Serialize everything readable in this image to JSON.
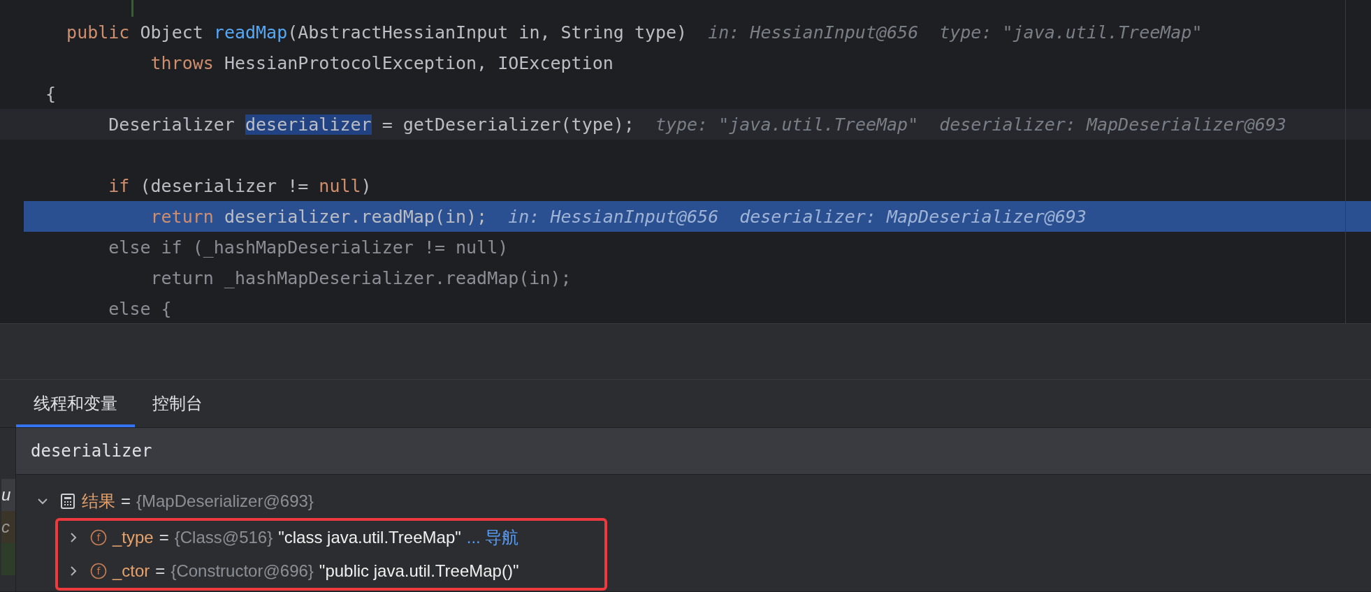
{
  "editor": {
    "lines": [
      {
        "current": false,
        "execution": false,
        "tokens": [
          {
            "text": "  public",
            "kind": "keyword"
          },
          {
            "text": " Object ",
            "kind": "plain"
          },
          {
            "text": "readMap",
            "kind": "method"
          },
          {
            "text": "(AbstractHessianInput in, String type)",
            "kind": "plain"
          }
        ],
        "hints": [
          "in: HessianInput@656",
          "type: \"java.util.TreeMap\""
        ]
      },
      {
        "current": false,
        "execution": false,
        "tokens": [
          {
            "text": "          throws",
            "kind": "keyword"
          },
          {
            "text": " HessianProtocolException, IOException",
            "kind": "plain"
          }
        ]
      },
      {
        "current": false,
        "execution": false,
        "tokens": [
          {
            "text": "{",
            "kind": "plain"
          }
        ]
      },
      {
        "current": true,
        "execution": false,
        "tokens": [
          {
            "text": "      Deserializer ",
            "kind": "plain"
          },
          {
            "text": "deserializer",
            "kind": "selection"
          },
          {
            "text": " = getDeserializer(type);",
            "kind": "plain"
          }
        ],
        "hints": [
          "type: \"java.util.TreeMap\"",
          "deserializer: MapDeserializer@693"
        ]
      },
      {
        "current": false,
        "execution": false
      },
      {
        "current": false,
        "execution": false,
        "tokens": [
          {
            "text": "      if",
            "kind": "keyword"
          },
          {
            "text": " (deserializer != ",
            "kind": "plain"
          },
          {
            "text": "null",
            "kind": "keyword"
          },
          {
            "text": ")",
            "kind": "plain"
          }
        ]
      },
      {
        "current": false,
        "execution": true,
        "tokens": [
          {
            "text": "          return",
            "kind": "keyword"
          },
          {
            "text": " deserializer.readMap(in);",
            "kind": "plain"
          }
        ],
        "hints": [
          "in: HessianInput@656",
          "deserializer: MapDeserializer@693"
        ]
      },
      {
        "current": false,
        "execution": false,
        "tokens": [
          {
            "text": "      else if (_hashMapDeserializer != null)",
            "kind": "dim"
          }
        ]
      },
      {
        "current": false,
        "execution": false,
        "tokens": [
          {
            "text": "          return _hashMapDeserializer.readMap(in);",
            "kind": "dim"
          }
        ]
      },
      {
        "current": false,
        "execution": false,
        "tokens": [
          {
            "text": "      else {",
            "kind": "dim"
          }
        ]
      }
    ]
  },
  "debug_panel": {
    "tabs": [
      {
        "label": "线程和变量",
        "selected": true
      },
      {
        "label": "控制台",
        "selected": false
      }
    ],
    "frames": [
      {
        "text": "u",
        "color": "#3a3c40"
      },
      {
        "text": "c",
        "color": "#3b3428"
      },
      {
        "color": "#2d3d2a"
      }
    ],
    "expression": {
      "value": "deserializer"
    },
    "variables": [
      {
        "kind": "result",
        "name": "结果",
        "separator": "=",
        "type": "{MapDeserializer@693}",
        "expanded": true,
        "children_outlined": true,
        "children": [
          {
            "kind": "field",
            "icon_text": "f",
            "name": "_type",
            "separator": "=",
            "type": "{Class@516}",
            "value": "\"class java.util.TreeMap\"",
            "link": "... 导航",
            "expanded": false
          },
          {
            "kind": "field",
            "icon_text": "f",
            "name": "_ctor",
            "separator": "=",
            "type": "{Constructor@696}",
            "value": "\"public java.util.TreeMap()\"",
            "expanded": false
          }
        ]
      }
    ]
  }
}
